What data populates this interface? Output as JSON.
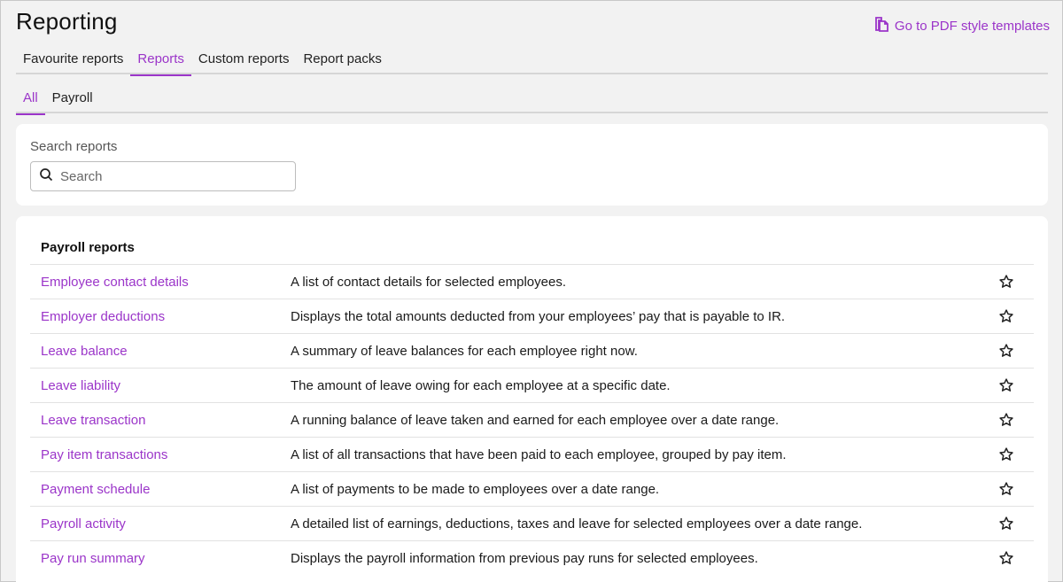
{
  "page": {
    "title": "Reporting"
  },
  "header": {
    "pdf_link_label": "Go to PDF style templates",
    "pdf_link_icon": "document-copy-icon"
  },
  "tabs_primary": [
    {
      "label": "Favourite reports"
    },
    {
      "label": "Reports",
      "active": true
    },
    {
      "label": "Custom reports"
    },
    {
      "label": "Report packs"
    }
  ],
  "tabs_secondary": [
    {
      "label": "All",
      "active": true
    },
    {
      "label": "Payroll"
    }
  ],
  "search": {
    "label": "Search reports",
    "placeholder": "Search",
    "value": ""
  },
  "reports": {
    "section_title": "Payroll reports",
    "rows": [
      {
        "name": "Employee contact details",
        "description": "A list of contact details for selected employees."
      },
      {
        "name": "Employer deductions",
        "description": "Displays the total amounts deducted from your employees’ pay that is payable to IR."
      },
      {
        "name": "Leave balance",
        "description": "A summary of leave balances for each employee right now."
      },
      {
        "name": "Leave liability",
        "description": "The amount of leave owing for each employee at a specific date."
      },
      {
        "name": "Leave transaction",
        "description": "A running balance of leave taken and earned for each employee over a date range."
      },
      {
        "name": "Pay item transactions",
        "description": "A list of all transactions that have been paid to each employee, grouped by pay item."
      },
      {
        "name": "Payment schedule",
        "description": "A list of payments to be made to employees over a date range."
      },
      {
        "name": "Payroll activity",
        "description": "A detailed list of earnings, deductions, taxes and leave for selected employees over a date range."
      },
      {
        "name": "Pay run summary",
        "description": "Displays the payroll information from previous pay runs for selected employees."
      }
    ]
  },
  "colors": {
    "accent": "#9b35c9",
    "background": "#f2f2f2",
    "card": "#ffffff"
  }
}
